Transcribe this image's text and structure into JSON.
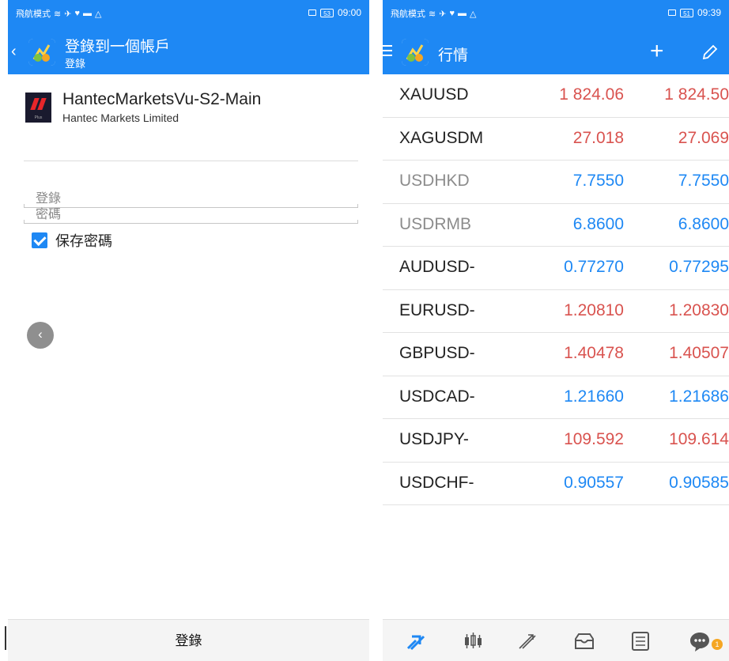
{
  "colors": {
    "accent": "#1e88f4",
    "up": "#d9534f",
    "down": "#1e88f4",
    "dim_symbol": "#8c8c8c"
  },
  "left_screen": {
    "status": {
      "left": "飛航模式",
      "right": "09:00",
      "battery": "53"
    },
    "header": {
      "back_icon": "chevron-left-icon",
      "title": "登錄到一個帳戶",
      "subtitle": "登錄"
    },
    "server": {
      "name": "HantecMarketsVu-S2-Main",
      "company": "Hantec Markets Limited",
      "logo_sub": "Plus"
    },
    "login_field": {
      "label": "登錄"
    },
    "password_field": {
      "label": "密碼"
    },
    "save_password": {
      "label": "保存密碼",
      "checked": true
    },
    "fab_icon": "chevron-left-icon",
    "login_button": {
      "label": "登錄"
    }
  },
  "right_screen": {
    "status": {
      "left": "飛航模式",
      "right": "09:39",
      "battery": "51"
    },
    "header": {
      "title": "行情",
      "add_label": "+"
    },
    "quotes": [
      {
        "symbol": "XAUUSD",
        "bid": "1 824.06",
        "ask": "1 824.50",
        "dir": "up",
        "dim": false
      },
      {
        "symbol": "XAGUSDM",
        "bid": "27.018",
        "ask": "27.069",
        "dir": "up",
        "dim": false
      },
      {
        "symbol": "USDHKD",
        "bid": "7.7550",
        "ask": "7.7550",
        "dir": "down",
        "dim": true
      },
      {
        "symbol": "USDRMB",
        "bid": "6.8600",
        "ask": "6.8600",
        "dir": "down",
        "dim": true
      },
      {
        "symbol": "AUDUSD-",
        "bid": "0.77270",
        "ask": "0.77295",
        "dir": "down",
        "dim": false
      },
      {
        "symbol": "EURUSD-",
        "bid": "1.20810",
        "ask": "1.20830",
        "dir": "up",
        "dim": false
      },
      {
        "symbol": "GBPUSD-",
        "bid": "1.40478",
        "ask": "1.40507",
        "dir": "up",
        "dim": false
      },
      {
        "symbol": "USDCAD-",
        "bid": "1.21660",
        "ask": "1.21686",
        "dir": "down",
        "dim": false
      },
      {
        "symbol": "USDJPY-",
        "bid": "109.592",
        "ask": "109.614",
        "dir": "up",
        "dim": false
      },
      {
        "symbol": "USDCHF-",
        "bid": "0.90557",
        "ask": "0.90585",
        "dir": "down",
        "dim": false
      }
    ],
    "bottom_nav": [
      {
        "icon": "quotes-icon",
        "active": true
      },
      {
        "icon": "chart-candles-icon",
        "active": false
      },
      {
        "icon": "trade-icon",
        "active": false
      },
      {
        "icon": "history-inbox-icon",
        "active": false
      },
      {
        "icon": "news-icon",
        "active": false
      },
      {
        "icon": "chat-icon",
        "active": false
      }
    ],
    "chat_badge": "1"
  }
}
